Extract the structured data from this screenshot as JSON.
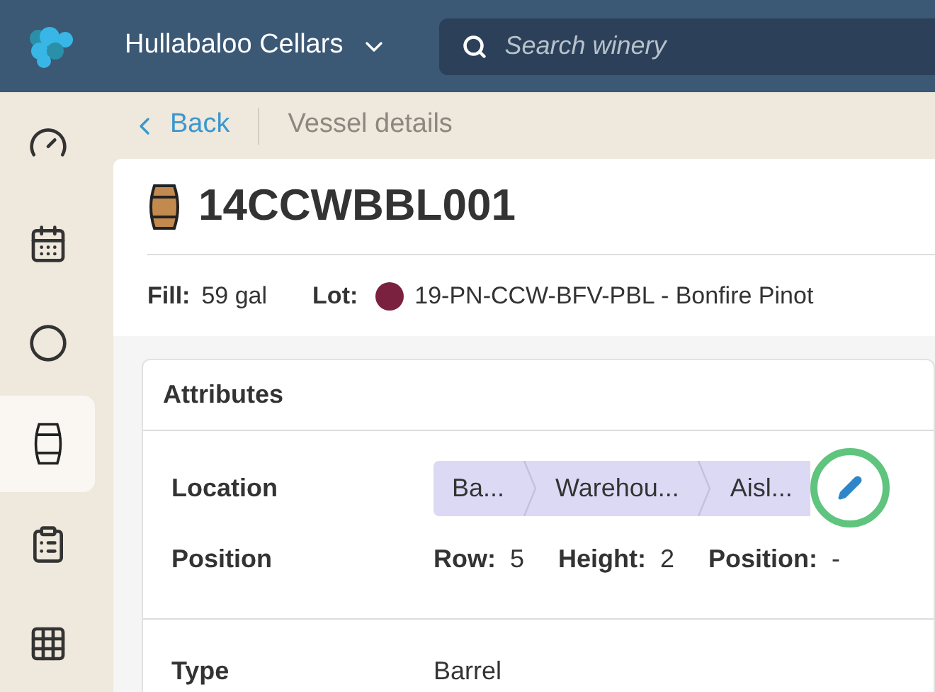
{
  "header": {
    "brand": "Hullabaloo Cellars",
    "search": {
      "placeholder": "Search winery"
    }
  },
  "sidebar": {
    "items": [
      {
        "selected": false
      },
      {
        "selected": false
      },
      {
        "selected": false
      },
      {
        "selected": true
      },
      {
        "selected": false
      },
      {
        "selected": false
      }
    ]
  },
  "breadcrumb": {
    "back": "Back",
    "current": "Vessel details"
  },
  "vessel": {
    "name": "14CCWBBL001",
    "fill_label": "Fill:",
    "fill": "59 gal",
    "lot_label": "Lot:",
    "lot": {
      "name": "19-PN-CCW-BFV-PBL - Bonfire Pinot",
      "color": "#7b2140"
    }
  },
  "attributes": {
    "title": "Attributes",
    "location_label": "Location",
    "location": [
      "Ba...",
      "Warehou...",
      "Aisl..."
    ],
    "edit_button": {
      "highlighted": true
    },
    "position_label": "Position",
    "position": [
      {
        "label": "Row:",
        "value": "5"
      },
      {
        "label": "Height:",
        "value": "2"
      },
      {
        "label": "Position:",
        "value": "-"
      }
    ],
    "type_label": "Type",
    "type": "Barrel"
  }
}
